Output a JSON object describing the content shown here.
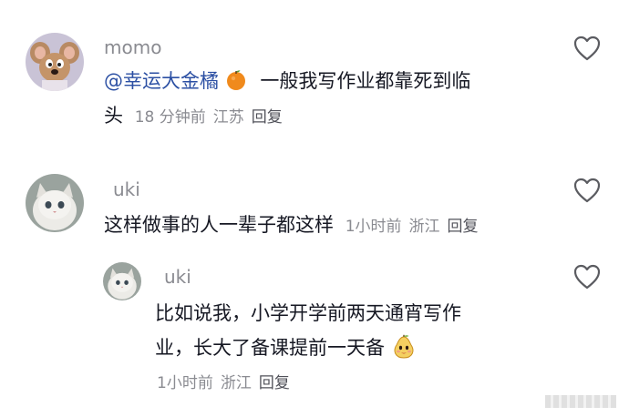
{
  "comments": [
    {
      "username": "momo",
      "mention": "@幸运大金橘",
      "mention_emoji": "orange-emoji",
      "text_line1": "一般我写作业都靠死到临",
      "text_line2": "头",
      "time": "18 分钟前",
      "location": "江苏",
      "reply_label": "回复"
    },
    {
      "username": "uki",
      "text": "这样做事的人一辈子都这样",
      "time": "1小时前",
      "location": "浙江",
      "reply_label": "回复"
    }
  ],
  "reply": {
    "username": "uki",
    "text_line1": "比如说我，小学开学前两天通宵写作",
    "text_line2": "业，长大了备课提前一天备",
    "emoji": "pear-face-emoji",
    "time": "1小时前",
    "location": "浙江",
    "reply_label": "回复"
  },
  "icons": {
    "like": "heart-outline-icon"
  }
}
